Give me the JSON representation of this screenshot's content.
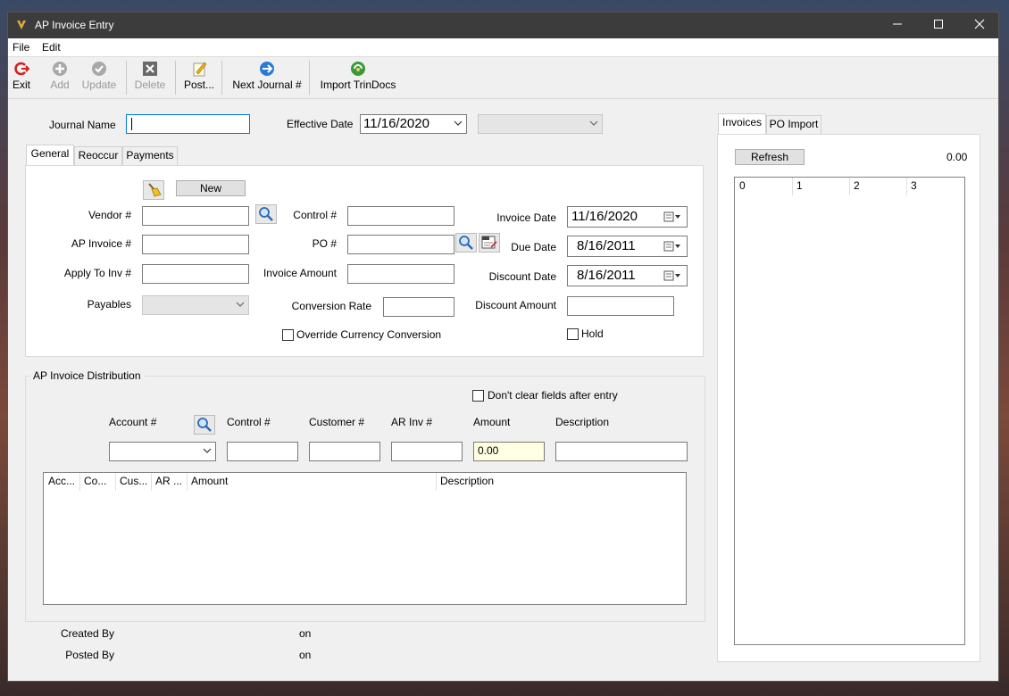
{
  "window": {
    "title": "AP Invoice Entry"
  },
  "menu": [
    "File",
    "Edit"
  ],
  "toolbar": [
    {
      "label": "Exit",
      "icon": "exit-icon",
      "enabled": true
    },
    {
      "label": "Add",
      "icon": "add-icon",
      "enabled": false
    },
    {
      "label": "Update",
      "icon": "update-icon",
      "enabled": false
    },
    {
      "label": "Delete",
      "icon": "delete-icon",
      "enabled": false
    },
    {
      "label": "Post...",
      "icon": "post-icon",
      "enabled": true
    },
    {
      "label": "Next Journal #",
      "icon": "next-journal-icon",
      "enabled": true
    },
    {
      "label": "Import TrinDocs",
      "icon": "import-trindocs-icon",
      "enabled": true
    }
  ],
  "header": {
    "journal_name_label": "Journal Name",
    "journal_name_value": "",
    "effective_date_label": "Effective Date",
    "effective_date_value": "11/16/2020",
    "period_value": ""
  },
  "tabs": [
    "General",
    "Reoccur",
    "Payments"
  ],
  "general": {
    "new_button": "New",
    "vendor_label": "Vendor #",
    "vendor_value": "",
    "ap_invoice_label": "AP Invoice #",
    "ap_invoice_value": "",
    "apply_to_inv_label": "Apply To Inv #",
    "apply_to_inv_value": "",
    "payables_label": "Payables",
    "payables_value": "",
    "control_label": "Control #",
    "control_value": "",
    "po_label": "PO #",
    "po_value": "",
    "invoice_amount_label": "Invoice Amount",
    "invoice_amount_value": "",
    "conversion_rate_label": "Conversion Rate",
    "conversion_rate_value": "",
    "override_label": "Override Currency Conversion",
    "invoice_date_label": "Invoice Date",
    "invoice_date_value": "11/16/2020",
    "due_date_label": "Due Date",
    "due_date_value": "8/16/2011",
    "discount_date_label": "Discount Date",
    "discount_date_value": "8/16/2011",
    "discount_amount_label": "Discount Amount",
    "discount_amount_value": "",
    "hold_label": "Hold"
  },
  "distribution": {
    "title": "AP Invoice Distribution",
    "dont_clear_label": "Don't clear fields after entry",
    "account_label": "Account #",
    "control_label": "Control #",
    "customer_label": "Customer #",
    "ar_inv_label": "AR Inv #",
    "amount_label": "Amount",
    "description_label": "Description",
    "account_value": "",
    "control_value": "",
    "customer_value": "",
    "ar_inv_value": "",
    "amount_value": "0.00",
    "description_value": "",
    "columns": [
      "Acc...",
      "Co...",
      "Cus...",
      "AR ...",
      "Amount",
      "Description"
    ]
  },
  "footer": {
    "created_by_label": "Created By",
    "created_on": "on",
    "posted_by_label": "Posted By",
    "posted_on": "on"
  },
  "right_panel": {
    "tabs": [
      "Invoices",
      "PO Import"
    ],
    "refresh_button": "Refresh",
    "total": "0.00",
    "columns": [
      "0",
      "1",
      "2",
      "3"
    ]
  },
  "colors": {
    "amount_bg": "#ffffe1",
    "focus_border": "#0078d7",
    "titlebar": "#3c3c3c"
  }
}
